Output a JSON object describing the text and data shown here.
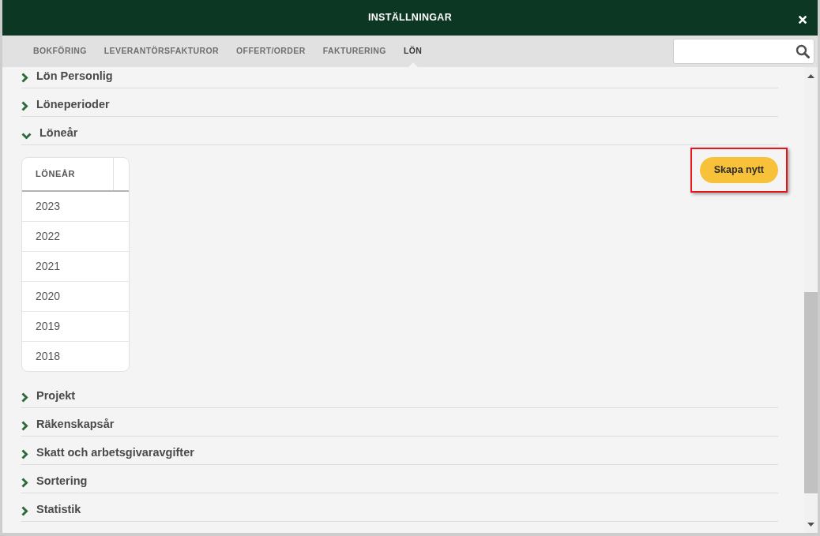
{
  "window": {
    "title": "INSTÄLLNINGAR"
  },
  "tabs": [
    {
      "label": "BOKFÖRING",
      "selected": false
    },
    {
      "label": "LEVERANTÖRSFAKTUROR",
      "selected": false
    },
    {
      "label": "OFFERT/ORDER",
      "selected": false
    },
    {
      "label": "FAKTURERING",
      "selected": false
    },
    {
      "label": "LÖN",
      "selected": true
    }
  ],
  "sections": [
    {
      "title": "Lön Personlig",
      "expanded": false
    },
    {
      "title": "Löneperioder",
      "expanded": false
    },
    {
      "title": "Löneår",
      "expanded": true,
      "table": {
        "columns": [
          "LÖNEÅR"
        ],
        "rows": [
          [
            "2023"
          ],
          [
            "2022"
          ],
          [
            "2021"
          ],
          [
            "2020"
          ],
          [
            "2019"
          ],
          [
            "2018"
          ]
        ]
      },
      "button": {
        "label": "Skapa nytt",
        "highlighted": true
      }
    },
    {
      "title": "Projekt",
      "expanded": false
    },
    {
      "title": "Räkenskapsår",
      "expanded": false
    },
    {
      "title": "Skatt och arbetsgivaravgifter",
      "expanded": false
    },
    {
      "title": "Sortering",
      "expanded": false
    },
    {
      "title": "Statistik",
      "expanded": false
    }
  ]
}
